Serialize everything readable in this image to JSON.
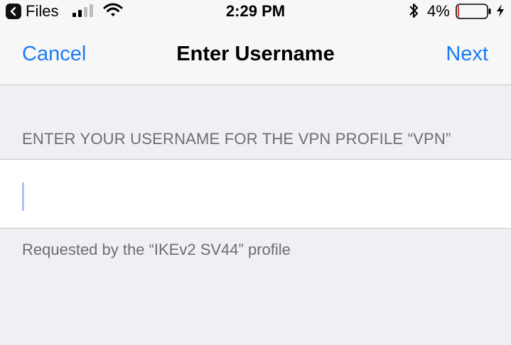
{
  "status_bar": {
    "back_app_label": "Files",
    "time": "2:29 PM",
    "battery_percent": "4%",
    "battery_level": 0.04,
    "icons": [
      "back-chevron-icon",
      "cellular-signal-icon",
      "wifi-icon",
      "bluetooth-icon",
      "battery-icon",
      "charging-bolt-icon"
    ]
  },
  "nav": {
    "cancel_label": "Cancel",
    "title": "Enter Username",
    "next_label": "Next"
  },
  "form": {
    "section_header": "ENTER YOUR USERNAME FOR THE VPN PROFILE “VPN”",
    "username_value": "",
    "footer_note": "Requested by the “IKEv2 SV44” profile"
  },
  "colors": {
    "accent": "#1a7cf4",
    "background": "#efeff4",
    "secondary_text": "#6d6d72",
    "battery_low": "#e53935"
  }
}
